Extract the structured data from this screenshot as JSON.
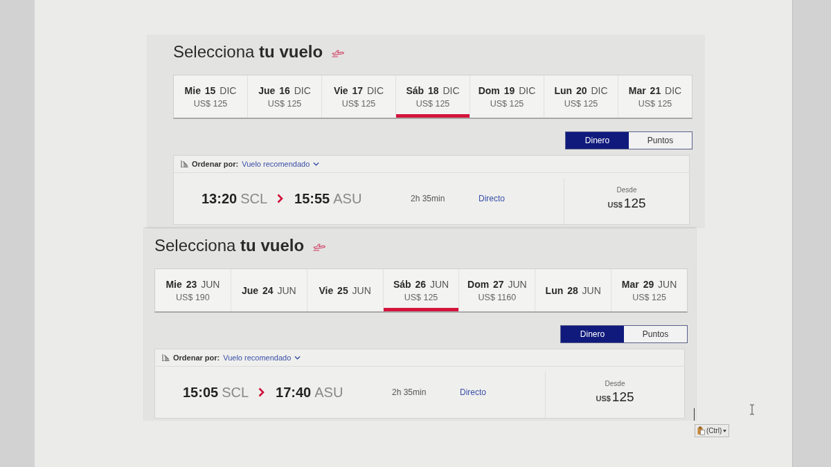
{
  "pasted_screenshots": [
    {
      "title": "Selecciona **tu vuelo**",
      "date_tabs": [
        {
          "day": "Mie 15",
          "month": "DIC",
          "price": "US$ 125",
          "selected": false
        },
        {
          "day": "Jue 16",
          "month": "DIC",
          "price": "US$ 125",
          "selected": false
        },
        {
          "day": "Vie 17",
          "month": "DIC",
          "price": "US$ 125",
          "selected": false
        },
        {
          "day": "Sáb 18",
          "month": "DIC",
          "price": "US$ 125",
          "selected": true
        },
        {
          "day": "Dom 19",
          "month": "DIC",
          "price": "US$ 125",
          "selected": false
        },
        {
          "day": "Lun 20",
          "month": "DIC",
          "price": "US$ 125",
          "selected": false
        },
        {
          "day": "Mar 21",
          "month": "DIC",
          "price": "US$ 125",
          "selected": false
        }
      ],
      "fare_toggle": [
        {
          "label": "Dinero",
          "selected": true
        },
        {
          "label": "Puntos",
          "selected": false
        }
      ],
      "sort": {
        "label": "Ordenar por:",
        "value": "Vuelo recomendado"
      },
      "flight": {
        "departure_time": "13:20",
        "origin": "SCL",
        "arrival_time": "15:55",
        "destination": "ASU",
        "duration": "2h 35min",
        "stops": "Directo",
        "price_label": "Desde",
        "currency": "US$",
        "amount": "125"
      }
    },
    {
      "title": "Selecciona **tu vuelo**",
      "date_tabs": [
        {
          "day": "Mie 23",
          "month": "JUN",
          "price": "US$ 190",
          "selected": false
        },
        {
          "day": "Jue 24",
          "month": "JUN",
          "selected": false
        },
        {
          "day": "Vie 25",
          "month": "JUN",
          "selected": false
        },
        {
          "day": "Sáb 26",
          "month": "JUN",
          "price": "US$ 125",
          "selected": true
        },
        {
          "day": "Dom 27",
          "month": "JUN",
          "price": "US$ 1160",
          "selected": false
        },
        {
          "day": "Lun 28",
          "month": "JUN",
          "selected": false
        },
        {
          "day": "Mar 29",
          "month": "JUN",
          "price": "US$ 125",
          "selected": false
        }
      ],
      "fare_toggle": [
        {
          "label": "Dinero",
          "selected": true
        },
        {
          "label": "Puntos",
          "selected": false
        }
      ],
      "sort": {
        "label": "Ordenar por:",
        "value": "Vuelo recomendado"
      },
      "flight": {
        "departure_time": "15:05",
        "origin": "SCL",
        "arrival_time": "17:40",
        "destination": "ASU",
        "duration": "2h 35min",
        "stops": "Directo",
        "price_label": "Desde",
        "currency": "US$",
        "amount": "125"
      }
    }
  ],
  "paste_options": {
    "label": "(Ctrl)"
  }
}
